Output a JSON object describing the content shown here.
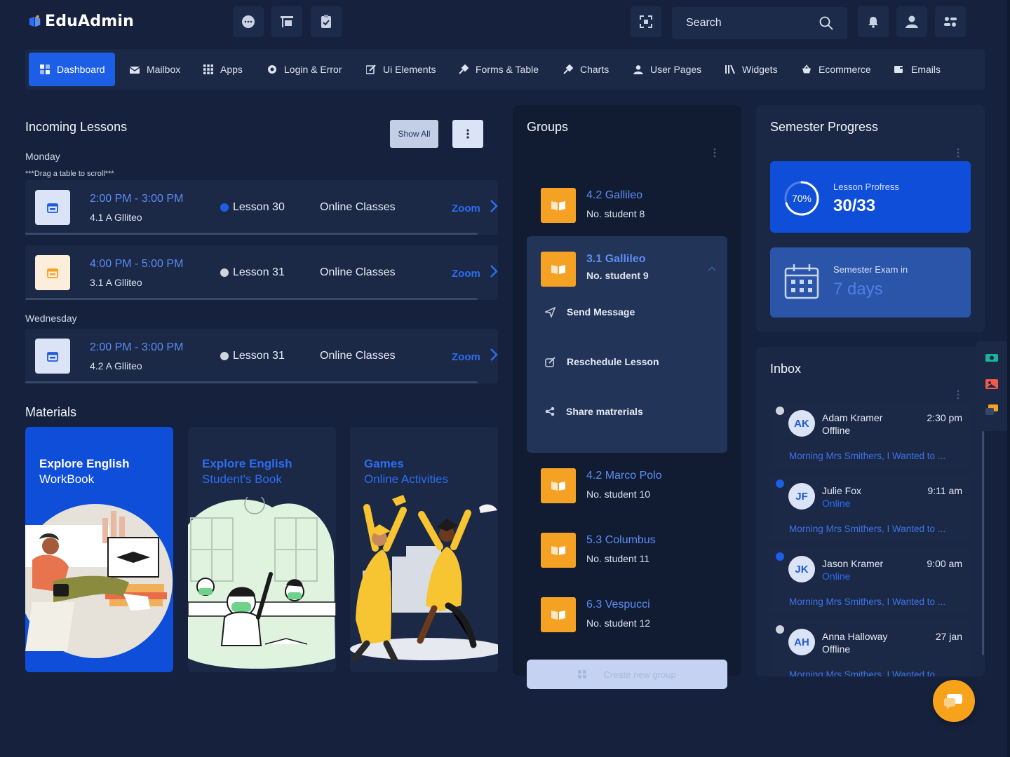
{
  "app": {
    "name": "EduAdmin"
  },
  "header": {
    "search": {
      "placeholder": "Search"
    }
  },
  "nav": {
    "items": [
      {
        "label": "Dashboard",
        "icon": "dashboard-icon",
        "active": true
      },
      {
        "label": "Mailbox",
        "icon": "mailbox-icon"
      },
      {
        "label": "Apps",
        "icon": "apps-icon"
      },
      {
        "label": "Login & Error",
        "icon": "login-icon"
      },
      {
        "label": "Ui Elements",
        "icon": "edit-icon"
      },
      {
        "label": "Forms & Table",
        "icon": "forms-icon"
      },
      {
        "label": "Charts",
        "icon": "charts-icon"
      },
      {
        "label": "User Pages",
        "icon": "user-icon"
      },
      {
        "label": "Widgets",
        "icon": "widgets-icon"
      },
      {
        "label": "Ecommerce",
        "icon": "basket-icon"
      },
      {
        "label": "Emails",
        "icon": "emails-icon"
      }
    ]
  },
  "lessons": {
    "title": "Incoming Lessons",
    "show_all": "Show All",
    "drag_note": "***Drag a table to scroll***",
    "days": [
      {
        "day": "Monday",
        "items": [
          {
            "time": "2:00 PM - 3:00 PM",
            "group": "4.1 A Glliteo",
            "lesson": "Lesson 30",
            "mode": "Online Classes",
            "action": "Zoom",
            "status_color": "#1c5ee6",
            "icon_bg": "#dbe4f7",
            "icon_color": "#1f5bd8"
          },
          {
            "time": "4:00 PM - 5:00 PM",
            "group": "3.1 A Glliteo",
            "lesson": "Lesson 31",
            "mode": "Online Classes",
            "action": "Zoom",
            "status_color": "#cfd4de",
            "icon_bg": "#fdeedb",
            "icon_color": "#f5a123"
          }
        ]
      },
      {
        "day": "Wednesday",
        "items": [
          {
            "time": "2:00 PM - 3:00 PM",
            "group": "4.2 A Glliteo",
            "lesson": "Lesson 31",
            "mode": "Online Classes",
            "action": "Zoom",
            "status_color": "#cfd4de",
            "icon_bg": "#dbe4f7",
            "icon_color": "#1f5bd8"
          }
        ]
      }
    ]
  },
  "materials": {
    "title": "Materials",
    "cards": [
      {
        "line1": "Explore English",
        "line2": "WorkBook",
        "bg": "#0f4ed8",
        "text_color": "#ffffff"
      },
      {
        "line1": "Explore English",
        "line2": "Student's Book",
        "bg": "#1b2846",
        "text_color": "#2c6df0"
      },
      {
        "line1": "Games",
        "line2": "Online Activities",
        "bg": "#1b2846",
        "text_color": "#2c6df0"
      }
    ]
  },
  "groups": {
    "title": "Groups",
    "items": [
      {
        "name": "4.2 Gallileo",
        "count": "No. student 8"
      },
      {
        "name": "3.1 Gallileo",
        "count": "No. student 9",
        "expanded": true
      },
      {
        "name": "4.2 Marco Polo",
        "count": "No. student 10"
      },
      {
        "name": "5.3 Columbus",
        "count": "No. student 11"
      },
      {
        "name": "6.3 Vespucci",
        "count": "No. student 12"
      }
    ],
    "actions": [
      "Send Message",
      "Reschedule Lesson",
      "Share matrerials"
    ],
    "create_label": "Create new group"
  },
  "semester": {
    "title": "Semester Progress",
    "progress": {
      "label": "Lesson Profress",
      "percent_text": "70%",
      "percent": 0.7,
      "value": "30/33"
    },
    "exam": {
      "label": "Semester Exam in",
      "value": "7 days"
    }
  },
  "inbox": {
    "title": "Inbox",
    "messages": [
      {
        "initials": "AK",
        "name": "Adam Kramer",
        "status": "Offline",
        "time": "2:30 pm",
        "preview": "Morning Mrs Smithers, I Wanted to ...",
        "unread": false
      },
      {
        "initials": "JF",
        "name": "Julie Fox",
        "status": "Online",
        "time": "9:11 am",
        "preview": "Morning Mrs Smithers, I Wanted to ...",
        "unread": true
      },
      {
        "initials": "JK",
        "name": "Jason Kramer",
        "status": "Online",
        "time": "9:00 am",
        "preview": "Morning Mrs Smithers, I Wanted to ...",
        "unread": true
      },
      {
        "initials": "AH",
        "name": "Anna Halloway",
        "status": "Offline",
        "time": "27 jan",
        "preview": "Morning Mrs Smithers, I Wanted to ...",
        "unread": false
      }
    ]
  },
  "colors": {
    "accent": "#1c5ee6",
    "orange": "#f5a123",
    "panel": "#1b2846",
    "bg": "#16223d"
  }
}
